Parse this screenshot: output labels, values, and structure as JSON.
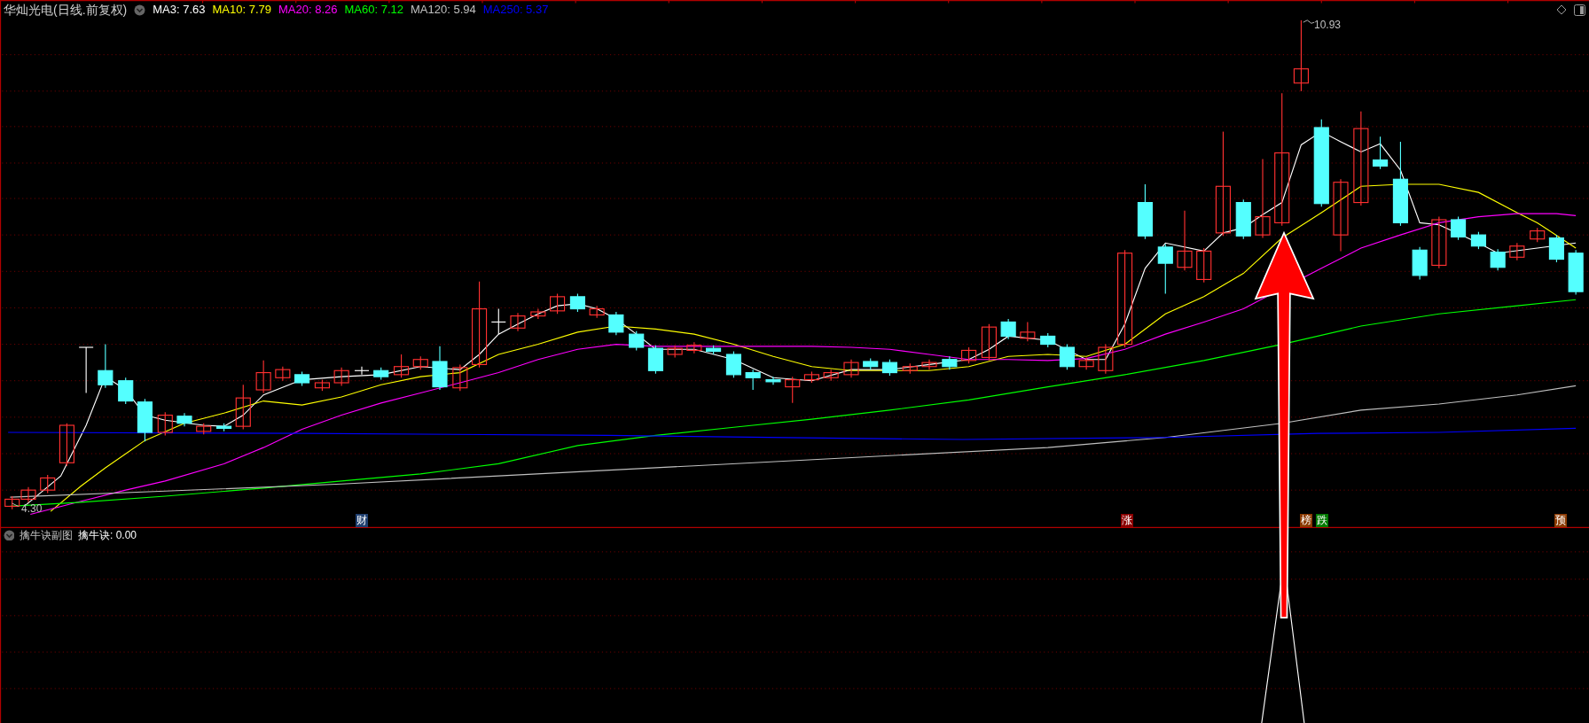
{
  "main_chart": {
    "title": "华灿光电(日线.前复权)",
    "indicators": [
      {
        "label": "MA3: 7.63",
        "color": "#ffffff"
      },
      {
        "label": "MA10: 7.79",
        "color": "#ffff00"
      },
      {
        "label": "MA20: 8.26",
        "color": "#ff00ff"
      },
      {
        "label": "MA60: 7.12",
        "color": "#00ff00"
      },
      {
        "label": "MA120: 5.94",
        "color": "#c0c0c0"
      },
      {
        "label": "MA250: 5.37",
        "color": "#0000ff"
      }
    ],
    "high_label": "10.93",
    "low_label": "4.30",
    "markers": [
      {
        "text": "财",
        "color": "#1f3f6f"
      },
      {
        "text": "涨",
        "color": "#8b0000"
      },
      {
        "text": "榜",
        "color": "#8b3a00"
      },
      {
        "text": "跌",
        "color": "#007a00"
      },
      {
        "text": "预",
        "color": "#8b3a00"
      }
    ]
  },
  "sub_chart": {
    "title": "擒牛诀副图",
    "indicator": "擒牛诀: 0.00"
  }
}
